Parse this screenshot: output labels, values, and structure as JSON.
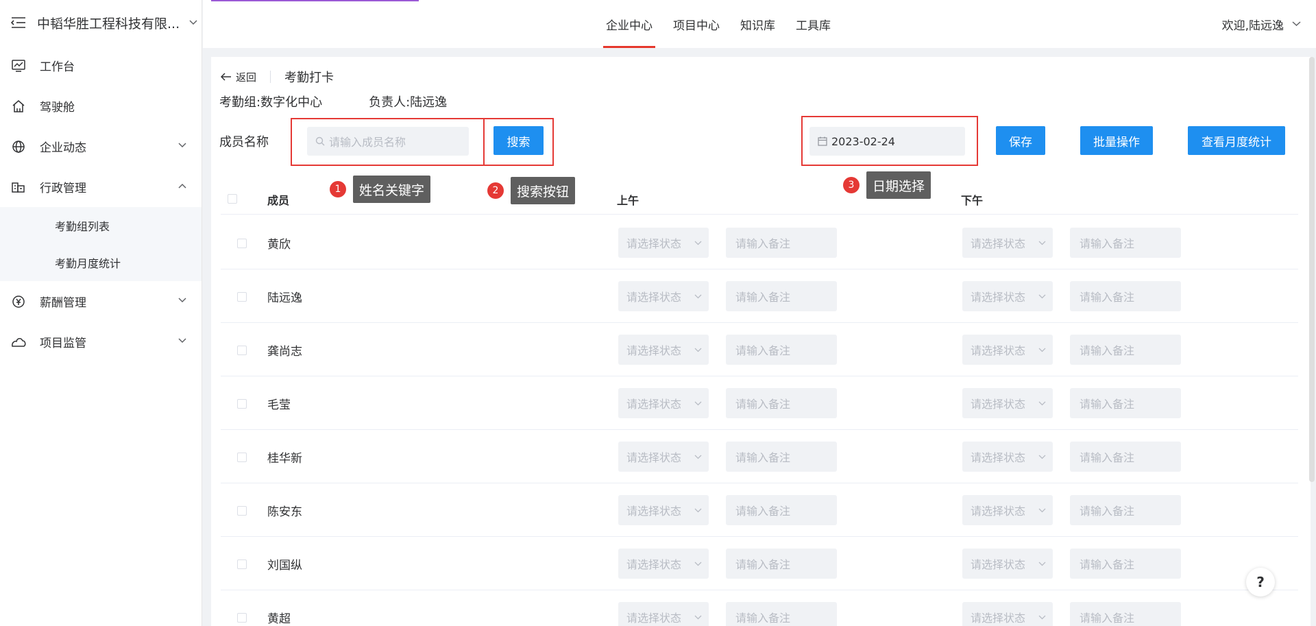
{
  "sidebar": {
    "company": "中韬华胜工程科技有限...",
    "items": [
      {
        "label": "工作台",
        "icon": "chart-icon"
      },
      {
        "label": "驾驶舱",
        "icon": "home-icon"
      },
      {
        "label": "企业动态",
        "icon": "globe-icon"
      },
      {
        "label": "行政管理",
        "icon": "building-icon"
      },
      {
        "label": "薪酬管理",
        "icon": "money-icon"
      },
      {
        "label": "项目监管",
        "icon": "cloud-icon"
      }
    ],
    "subitems": [
      "考勤组列表",
      "考勤月度统计"
    ]
  },
  "topnav": {
    "tabs": [
      "企业中心",
      "项目中心",
      "知识库",
      "工具库"
    ],
    "active_tab": "企业中心",
    "welcome": "欢迎,陆远逸"
  },
  "page": {
    "back_label": "返回",
    "title": "考勤打卡",
    "group": "考勤组:数字化中心",
    "owner": "负责人:陆远逸",
    "member_label": "成员名称",
    "search_placeholder": "请输入成员名称",
    "search_button": "搜索",
    "date_value": "2023-02-24",
    "save_button": "保存",
    "batch_button": "批量操作",
    "monthly_button": "查看月度统计"
  },
  "callouts": [
    {
      "num": "1",
      "text": "姓名关键字"
    },
    {
      "num": "2",
      "text": "搜索按钮"
    },
    {
      "num": "3",
      "text": "日期选择"
    }
  ],
  "table": {
    "headers": {
      "member": "成员",
      "morning": "上午",
      "afternoon": "下午"
    },
    "status_placeholder": "请选择状态",
    "note_placeholder": "请输入备注",
    "rows": [
      "黄欣",
      "陆远逸",
      "龚尚志",
      "毛莹",
      "桂华新",
      "陈安东",
      "刘国纵",
      "黄超"
    ]
  },
  "help": "?",
  "colors": {
    "primary": "#1e8ff0",
    "active_tab": "#e6382c",
    "highlight": "#e53935",
    "callout_tag": "#5f5f5f"
  }
}
